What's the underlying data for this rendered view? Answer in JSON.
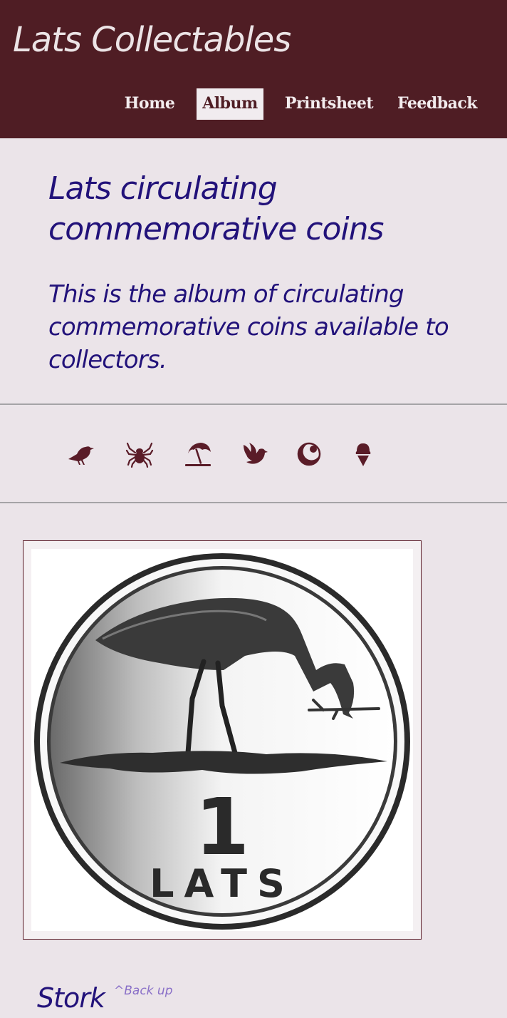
{
  "site": {
    "title": "Lats Collectables"
  },
  "nav": {
    "home": "Home",
    "album": "Album",
    "printsheet": "Printsheet",
    "feedback": "Feedback",
    "active": "album"
  },
  "page": {
    "heading": "Lats circulating commemorative coins",
    "intro": "This is the album of circulating commemorative coins available to collectors."
  },
  "category_icons": [
    "bird-icon",
    "spider-icon",
    "beach-umbrella-icon",
    "dove-icon",
    "moon-icon",
    "ice-cream-icon"
  ],
  "colors": {
    "header_bg": "#4f1d24",
    "page_bg": "#ebe4e9",
    "heading_text": "#22127a",
    "icon_color": "#5a1c28",
    "link_color": "#8a70c8"
  },
  "coin": {
    "denomination": "1",
    "currency": "LATS",
    "name": "Stork",
    "back_up_label": "^Back up"
  }
}
